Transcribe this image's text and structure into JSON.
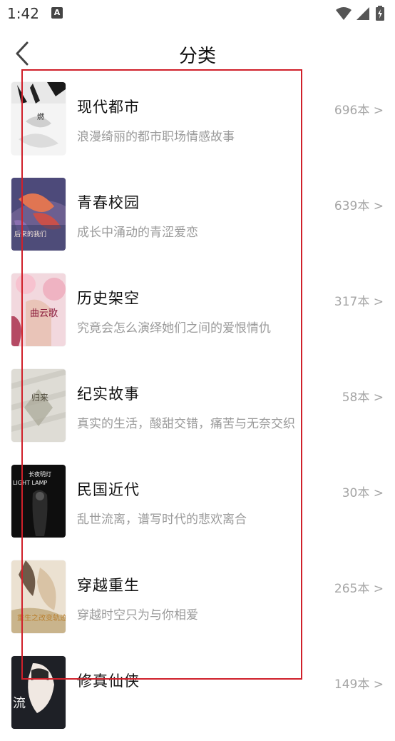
{
  "status_bar": {
    "time": "1:42",
    "app_indicator": "A",
    "icons": [
      "wifi-icon",
      "signal-icon",
      "battery-charging-icon"
    ]
  },
  "header": {
    "title": "分类",
    "back_icon": "chevron-left-icon"
  },
  "categories": [
    {
      "name": "现代都市",
      "desc": "浪漫绮丽的都市职场情感故事",
      "count": "696本 >"
    },
    {
      "name": "青春校园",
      "desc": "成长中涌动的青涩爱恋",
      "count": "639本 >"
    },
    {
      "name": "历史架空",
      "desc": "究竟会怎么演绎她们之间的爱恨情仇",
      "count": "317本 >"
    },
    {
      "name": "纪实故事",
      "desc": "真实的生活，酸甜交错，痛苦与无奈交织",
      "count": "58本 >"
    },
    {
      "name": "民国近代",
      "desc": "乱世流离，谱写时代的悲欢离合",
      "count": "30本 >"
    },
    {
      "name": "穿越重生",
      "desc": "穿越时空只为与你相爱",
      "count": "265本 >"
    },
    {
      "name": "修真仙侠",
      "desc": "",
      "count": "149本 >"
    }
  ],
  "covers": {
    "0": {
      "text_main": "燃",
      "colors": {
        "bg": "#f2f2f2",
        "ink": "#1a1a1a"
      }
    },
    "1": {
      "text_main": "后来的我们",
      "colors": {
        "bg": "#6a5a8c",
        "accent": "#e0704a"
      }
    },
    "2": {
      "text_main": "曲云歌",
      "colors": {
        "bg": "#f1d6dc",
        "accent": "#8c2040"
      }
    },
    "3": {
      "text_main": "归来",
      "colors": {
        "bg": "#d8d6cf",
        "accent": "#6f6a5c"
      }
    },
    "4": {
      "text_top": "长夜明灯",
      "text_sub": "LIGHT LAMP",
      "colors": {
        "bg": "#0d0d0d",
        "ink": "#eeeeee"
      }
    },
    "5": {
      "text_main": "重生之改变轨迹",
      "colors": {
        "bg": "#e7dccb",
        "accent": "#b58a4a"
      }
    },
    "6": {
      "text_main": "流",
      "colors": {
        "bg": "#1d1f24",
        "accent": "#f0e9e4"
      }
    }
  },
  "colors": {
    "highlight": "#d0202a"
  }
}
